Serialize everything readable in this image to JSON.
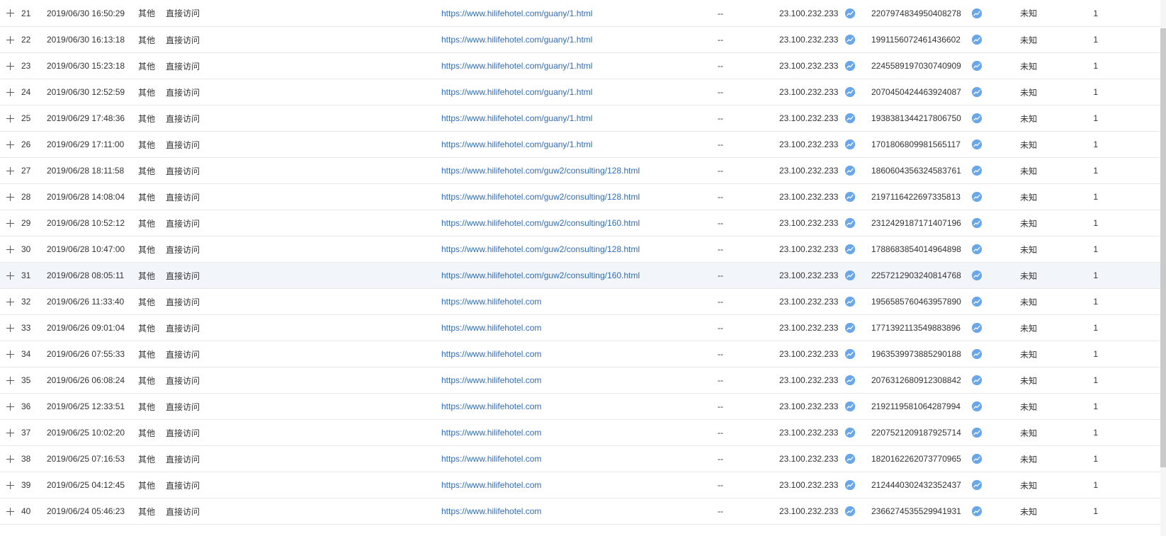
{
  "colors": {
    "link": "#2f6cb5",
    "icon": "#6aa7e8",
    "highlight_row": "#f2f6fb"
  },
  "icons": {
    "expand": "plus-icon",
    "trend": "trend-chart-icon"
  },
  "rows": [
    {
      "idx": "21",
      "time": "2019/06/30 16:50:29",
      "type": "其他",
      "source": "直接访问",
      "url": "https://www.hilifehotel.com/guany/1.html",
      "keyword": "--",
      "ip": "23.100.232.233",
      "visitor_id": "2207974834950408278",
      "status": "未知",
      "pv": "1"
    },
    {
      "idx": "22",
      "time": "2019/06/30 16:13:18",
      "type": "其他",
      "source": "直接访问",
      "url": "https://www.hilifehotel.com/guany/1.html",
      "keyword": "--",
      "ip": "23.100.232.233",
      "visitor_id": "1991156072461436602",
      "status": "未知",
      "pv": "1"
    },
    {
      "idx": "23",
      "time": "2019/06/30 15:23:18",
      "type": "其他",
      "source": "直接访问",
      "url": "https://www.hilifehotel.com/guany/1.html",
      "keyword": "--",
      "ip": "23.100.232.233",
      "visitor_id": "2245589197030740909",
      "status": "未知",
      "pv": "1"
    },
    {
      "idx": "24",
      "time": "2019/06/30 12:52:59",
      "type": "其他",
      "source": "直接访问",
      "url": "https://www.hilifehotel.com/guany/1.html",
      "keyword": "--",
      "ip": "23.100.232.233",
      "visitor_id": "2070450424463924087",
      "status": "未知",
      "pv": "1"
    },
    {
      "idx": "25",
      "time": "2019/06/29 17:48:36",
      "type": "其他",
      "source": "直接访问",
      "url": "https://www.hilifehotel.com/guany/1.html",
      "keyword": "--",
      "ip": "23.100.232.233",
      "visitor_id": "1938381344217806750",
      "status": "未知",
      "pv": "1"
    },
    {
      "idx": "26",
      "time": "2019/06/29 17:11:00",
      "type": "其他",
      "source": "直接访问",
      "url": "https://www.hilifehotel.com/guany/1.html",
      "keyword": "--",
      "ip": "23.100.232.233",
      "visitor_id": "1701806809981565117",
      "status": "未知",
      "pv": "1"
    },
    {
      "idx": "27",
      "time": "2019/06/28 18:11:58",
      "type": "其他",
      "source": "直接访问",
      "url": "https://www.hilifehotel.com/guw2/consulting/128.html",
      "keyword": "--",
      "ip": "23.100.232.233",
      "visitor_id": "1860604356324583761",
      "status": "未知",
      "pv": "1"
    },
    {
      "idx": "28",
      "time": "2019/06/28 14:08:04",
      "type": "其他",
      "source": "直接访问",
      "url": "https://www.hilifehotel.com/guw2/consulting/128.html",
      "keyword": "--",
      "ip": "23.100.232.233",
      "visitor_id": "2197116422697335813",
      "status": "未知",
      "pv": "1"
    },
    {
      "idx": "29",
      "time": "2019/06/28 10:52:12",
      "type": "其他",
      "source": "直接访问",
      "url": "https://www.hilifehotel.com/guw2/consulting/160.html",
      "keyword": "--",
      "ip": "23.100.232.233",
      "visitor_id": "2312429187171407196",
      "status": "未知",
      "pv": "1"
    },
    {
      "idx": "30",
      "time": "2019/06/28 10:47:00",
      "type": "其他",
      "source": "直接访问",
      "url": "https://www.hilifehotel.com/guw2/consulting/128.html",
      "keyword": "--",
      "ip": "23.100.232.233",
      "visitor_id": "1788683854014964898",
      "status": "未知",
      "pv": "1"
    },
    {
      "idx": "31",
      "time": "2019/06/28 08:05:11",
      "type": "其他",
      "source": "直接访问",
      "url": "https://www.hilifehotel.com/guw2/consulting/160.html",
      "keyword": "--",
      "ip": "23.100.232.233",
      "visitor_id": "2257212903240814768",
      "status": "未知",
      "pv": "1",
      "highlight": true
    },
    {
      "idx": "32",
      "time": "2019/06/26 11:33:40",
      "type": "其他",
      "source": "直接访问",
      "url": "https://www.hilifehotel.com",
      "keyword": "--",
      "ip": "23.100.232.233",
      "visitor_id": "1956585760463957890",
      "status": "未知",
      "pv": "1"
    },
    {
      "idx": "33",
      "time": "2019/06/26 09:01:04",
      "type": "其他",
      "source": "直接访问",
      "url": "https://www.hilifehotel.com",
      "keyword": "--",
      "ip": "23.100.232.233",
      "visitor_id": "1771392113549883896",
      "status": "未知",
      "pv": "1"
    },
    {
      "idx": "34",
      "time": "2019/06/26 07:55:33",
      "type": "其他",
      "source": "直接访问",
      "url": "https://www.hilifehotel.com",
      "keyword": "--",
      "ip": "23.100.232.233",
      "visitor_id": "1963539973885290188",
      "status": "未知",
      "pv": "1"
    },
    {
      "idx": "35",
      "time": "2019/06/26 06:08:24",
      "type": "其他",
      "source": "直接访问",
      "url": "https://www.hilifehotel.com",
      "keyword": "--",
      "ip": "23.100.232.233",
      "visitor_id": "2076312680912308842",
      "status": "未知",
      "pv": "1"
    },
    {
      "idx": "36",
      "time": "2019/06/25 12:33:51",
      "type": "其他",
      "source": "直接访问",
      "url": "https://www.hilifehotel.com",
      "keyword": "--",
      "ip": "23.100.232.233",
      "visitor_id": "2192119581064287994",
      "status": "未知",
      "pv": "1"
    },
    {
      "idx": "37",
      "time": "2019/06/25 10:02:20",
      "type": "其他",
      "source": "直接访问",
      "url": "https://www.hilifehotel.com",
      "keyword": "--",
      "ip": "23.100.232.233",
      "visitor_id": "2207521209187925714",
      "status": "未知",
      "pv": "1"
    },
    {
      "idx": "38",
      "time": "2019/06/25 07:16:53",
      "type": "其他",
      "source": "直接访问",
      "url": "https://www.hilifehotel.com",
      "keyword": "--",
      "ip": "23.100.232.233",
      "visitor_id": "1820162262073770965",
      "status": "未知",
      "pv": "1"
    },
    {
      "idx": "39",
      "time": "2019/06/25 04:12:45",
      "type": "其他",
      "source": "直接访问",
      "url": "https://www.hilifehotel.com",
      "keyword": "--",
      "ip": "23.100.232.233",
      "visitor_id": "2124440302432352437",
      "status": "未知",
      "pv": "1"
    },
    {
      "idx": "40",
      "time": "2019/06/24 05:46:23",
      "type": "其他",
      "source": "直接访问",
      "url": "https://www.hilifehotel.com",
      "keyword": "--",
      "ip": "23.100.232.233",
      "visitor_id": "2366274535529941931",
      "status": "未知",
      "pv": "1"
    }
  ]
}
